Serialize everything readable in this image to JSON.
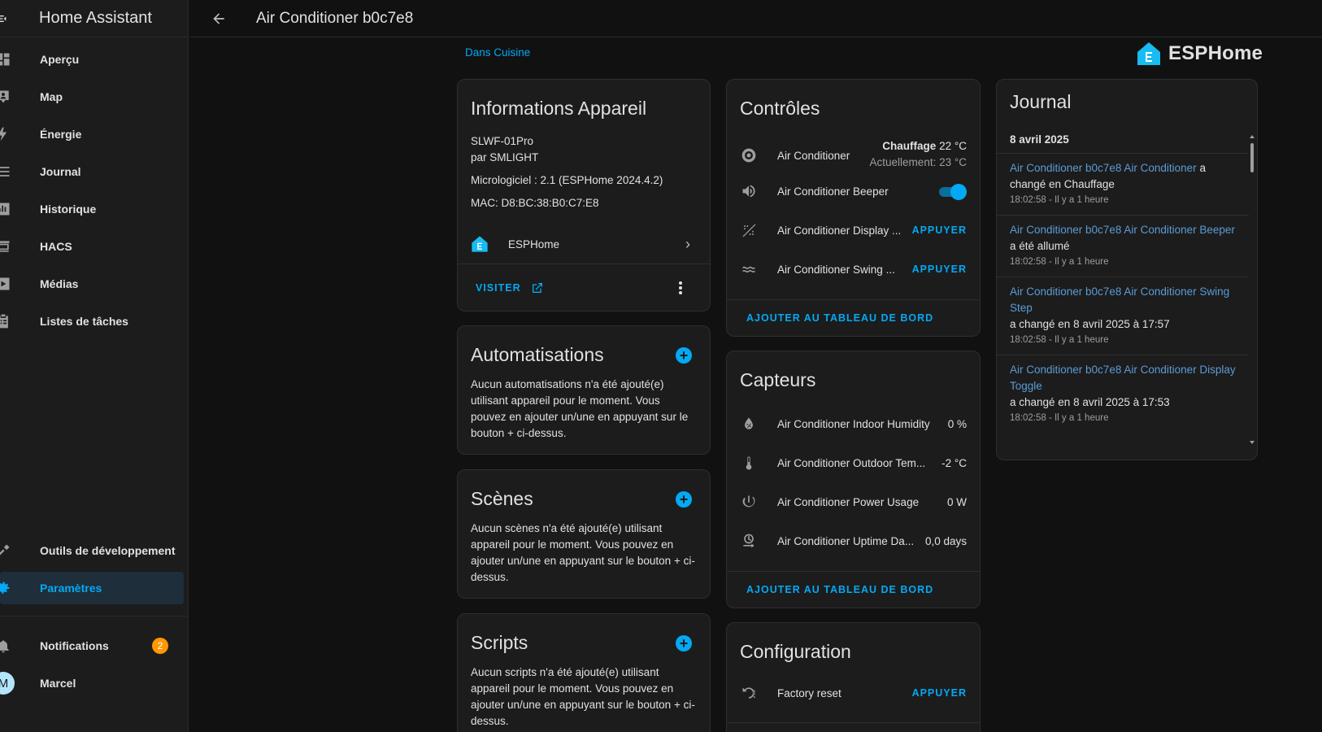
{
  "app": {
    "title": "Home Assistant"
  },
  "sidebar": {
    "items": [
      {
        "label": "Aperçu",
        "icon": "dashboard-icon"
      },
      {
        "label": "Map",
        "icon": "map-person-icon"
      },
      {
        "label": "Énergie",
        "icon": "lightning-icon"
      },
      {
        "label": "Journal",
        "icon": "list-icon"
      },
      {
        "label": "Historique",
        "icon": "chart-bar-icon"
      },
      {
        "label": "HACS",
        "icon": "hacs-icon"
      },
      {
        "label": "Médias",
        "icon": "play-box-icon"
      },
      {
        "label": "Listes de tâches",
        "icon": "clipboard-list-icon"
      }
    ],
    "dev_tools": "Outils de développement",
    "settings": "Paramètres",
    "notifications": "Notifications",
    "notifications_count": "2",
    "user": {
      "name": "Marcel",
      "initial": "M"
    }
  },
  "header": {
    "title": "Air Conditioner b0c7e8"
  },
  "area_link": "Dans Cuisine",
  "brand": {
    "name": "ESPHome"
  },
  "device_info": {
    "title": "Informations Appareil",
    "model": "SLWF-01Pro",
    "manufacturer": "par SMLIGHT",
    "firmware": "Micrologiciel : 2.1 (ESPHome 2024.4.2)",
    "mac": "MAC: D8:BC:38:B0:C7:E8",
    "integration": "ESPHome",
    "visit": "VISITER"
  },
  "automations": {
    "title": "Automatisations",
    "text": "Aucun automatisations n'a été ajouté(e) utilisant appareil pour le moment. Vous pouvez en ajouter un/une en appuyant sur le bouton + ci-dessus."
  },
  "scenes": {
    "title": "Scènes",
    "text": "Aucun scènes n'a été ajouté(e) utilisant appareil pour le moment. Vous pouvez en ajouter un/une en appuyant sur le bouton + ci-dessus."
  },
  "scripts": {
    "title": "Scripts",
    "text": "Aucun scripts n'a été ajouté(e) utilisant appareil pour le moment. Vous pouvez en ajouter un/une en appuyant sur le bouton + ci-dessus."
  },
  "controls": {
    "title": "Contrôles",
    "climate": {
      "name": "Air Conditioner",
      "mode": "Chauffage",
      "target": "22 °C",
      "current": "Actuellement: 23 °C"
    },
    "beeper": {
      "name": "Air Conditioner Beeper",
      "state": "on"
    },
    "display": {
      "name": "Air Conditioner Display ...",
      "action": "APPUYER"
    },
    "swing": {
      "name": "Air Conditioner Swing ...",
      "action": "APPUYER"
    },
    "add_dashboard": "AJOUTER AU TABLEAU DE BORD"
  },
  "sensors": {
    "title": "Capteurs",
    "items": [
      {
        "name": "Air Conditioner Indoor Humidity",
        "value": "0 %",
        "icon": "water-percent-icon"
      },
      {
        "name": "Air Conditioner Outdoor Tem...",
        "value": "-2 °C",
        "icon": "thermometer-icon"
      },
      {
        "name": "Air Conditioner Power Usage",
        "value": "0 W",
        "icon": "power-icon"
      },
      {
        "name": "Air Conditioner Uptime Da...",
        "value": "0,0 days",
        "icon": "timer-arrow-icon"
      }
    ],
    "add_dashboard": "AJOUTER AU TABLEAU DE BORD"
  },
  "configuration": {
    "title": "Configuration",
    "factory_reset": {
      "name": "Factory reset",
      "action": "APPUYER"
    }
  },
  "journal": {
    "title": "Journal",
    "date": "8 avril 2025",
    "entries": [
      {
        "entity": "Air Conditioner b0c7e8 Air Conditioner",
        "event": "a",
        "event2": "changé en Chauffage",
        "time": "18:02:58 - Il y a 1 heure"
      },
      {
        "entity": "Air Conditioner b0c7e8 Air Conditioner Beeper",
        "event": "a été allumé",
        "time": "18:02:58 - Il y a 1 heure"
      },
      {
        "entity": "Air Conditioner b0c7e8 Air Conditioner Swing Step",
        "event": "a changé en 8 avril 2025 à 17:57",
        "time": "18:02:58 - Il y a 1 heure"
      },
      {
        "entity": "Air Conditioner b0c7e8 Air Conditioner Display Toggle",
        "event": "a changé en 8 avril 2025 à 17:53",
        "time": "18:02:58 - Il y a 1 heure"
      }
    ]
  },
  "colors": {
    "accent": "#03a9f4",
    "badge": "#ff9800",
    "link": "#5b9bd5",
    "background": "#111111",
    "card": "#1c1c1c"
  }
}
